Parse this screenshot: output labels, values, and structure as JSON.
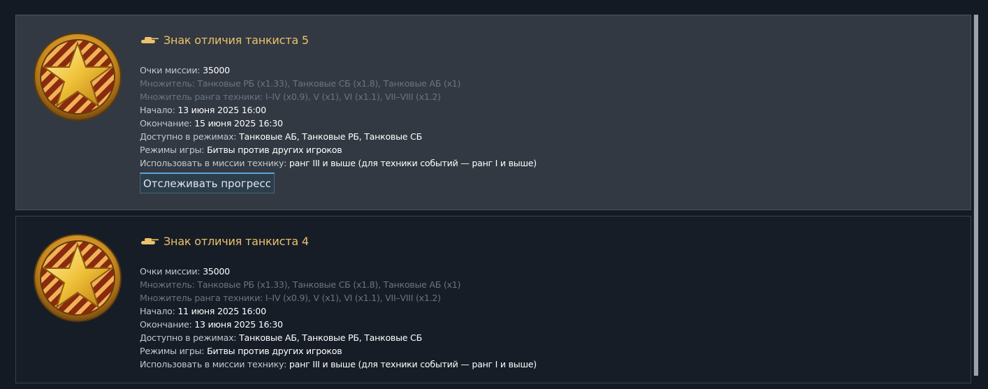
{
  "missions": [
    {
      "title": "Знак отличия танкиста 5",
      "points_label": "Очки миссии:",
      "points_value": "35000",
      "multiplier": "Множитель: Танковые РБ (x1.33), Танковые СБ (x1.8), Танковые АБ (x1)",
      "rank_multiplier": "Множитель ранга техники: I–IV (x0.9), V (x1), VI (x1.1), VII–VIII (x1.2)",
      "start_label": "Начало:",
      "start_value": "13 июня 2025 16:00",
      "end_label": "Окончание:",
      "end_value": "15 июня 2025 16:30",
      "modes_label": "Доступно в режимах:",
      "modes_value": "Танковые АБ, Танковые РБ, Танковые СБ",
      "game_modes_label": "Режимы игры:",
      "game_modes_value": "Битвы против других игроков",
      "vehicles_label": "Использовать в миссии технику:",
      "vehicles_value": "ранг III и выше (для техники событий — ранг I и выше)",
      "track_button": "Отслеживать прогресс"
    },
    {
      "title": "Знак отличия танкиста 4",
      "points_label": "Очки миссии:",
      "points_value": "35000",
      "multiplier": "Множитель: Танковые РБ (x1.33), Танковые СБ (x1.8), Танковые АБ (x1)",
      "rank_multiplier": "Множитель ранга техники: I–IV (x0.9), V (x1), VI (x1.1), VII–VIII (x1.2)",
      "start_label": "Начало:",
      "start_value": "11 июня 2025 16:00",
      "end_label": "Окончание:",
      "end_value": "13 июня 2025 16:30",
      "modes_label": "Доступно в режимах:",
      "modes_value": "Танковые АБ, Танковые РБ, Танковые СБ",
      "game_modes_label": "Режимы игры:",
      "game_modes_value": "Битвы против других игроков",
      "vehicles_label": "Использовать в миссии технику:",
      "vehicles_value": "ранг III и выше (для техники событий — ранг I и выше)"
    }
  ],
  "icons": {
    "tank": "tank-icon",
    "medal": "star-medal-icon"
  },
  "colors": {
    "title": "#ecc26a",
    "accent": "#5aa6d6",
    "dim_text": "#6b7480"
  }
}
